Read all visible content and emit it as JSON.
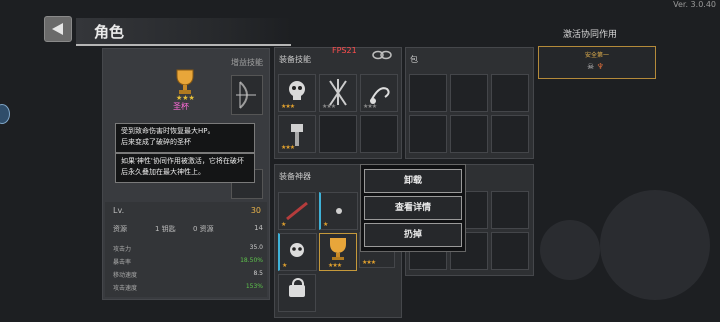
{
  "version": "Ver. 3.0.40",
  "header": {
    "title": "角色"
  },
  "fps": "FPS21",
  "character": {
    "equip_tab": "增益技能",
    "relic_label": "圣杯",
    "tooltip1": [
      "受到致命伤害时恢复最大HP。",
      "后来变成了破碎的圣杯"
    ],
    "tooltip2": [
      "如果'神性'协同作用被激活，它将在破坏",
      "后永久叠加在最大神性上。"
    ],
    "lv_label": "Lv.",
    "lv_value": "30",
    "resource1_label": "资源",
    "resource1_value": "1 钥匙",
    "resource2_label": "0 资源",
    "resource2_value": "14",
    "stats": [
      {
        "label": "攻击力",
        "value": "35.0"
      },
      {
        "label": "暴击率",
        "value": "18.50%"
      },
      {
        "label": "移动速度",
        "value": "8.5"
      },
      {
        "label": "攻击速度",
        "value": "153%"
      }
    ]
  },
  "skills": {
    "title": "装备技能"
  },
  "artifacts": {
    "title": "装备神器"
  },
  "bag": {
    "title": "包"
  },
  "context_menu": {
    "unload": "卸载",
    "details": "查看详情",
    "discard": "扔掉"
  },
  "synergy": {
    "heading": "激活协同作用",
    "item_label": "安全第一"
  },
  "icons": [
    "back-arrow-icon",
    "link-icon",
    "trophy-icon",
    "lock-icon",
    "skull-icon"
  ]
}
